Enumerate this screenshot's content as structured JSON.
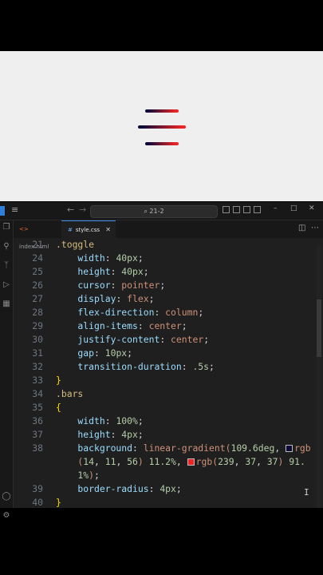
{
  "titlebar": {
    "search_text": "⌕ 21-2"
  },
  "tabs": [
    {
      "label": "index.html",
      "icon": "html-file-icon",
      "active": false
    },
    {
      "label": "style.css",
      "icon": "css-file-icon",
      "active": true
    }
  ],
  "code_lines": [
    {
      "n": "21",
      "parts": [
        [
          "sel",
          ".toggle"
        ]
      ]
    },
    {
      "n": "24",
      "parts": [
        [
          "prop",
          "    width"
        ],
        [
          "pun",
          ": "
        ],
        [
          "num",
          "40px"
        ],
        [
          "pun",
          ";"
        ]
      ]
    },
    {
      "n": "25",
      "parts": [
        [
          "prop",
          "    height"
        ],
        [
          "pun",
          ": "
        ],
        [
          "num",
          "40px"
        ],
        [
          "pun",
          ";"
        ]
      ]
    },
    {
      "n": "26",
      "parts": [
        [
          "prop",
          "    cursor"
        ],
        [
          "pun",
          ": "
        ],
        [
          "val",
          "pointer"
        ],
        [
          "pun",
          ";"
        ]
      ]
    },
    {
      "n": "27",
      "parts": [
        [
          "prop",
          "    display"
        ],
        [
          "pun",
          ": "
        ],
        [
          "val",
          "flex"
        ],
        [
          "pun",
          ";"
        ]
      ]
    },
    {
      "n": "28",
      "parts": [
        [
          "prop",
          "    flex-direction"
        ],
        [
          "pun",
          ": "
        ],
        [
          "val",
          "column"
        ],
        [
          "pun",
          ";"
        ]
      ]
    },
    {
      "n": "29",
      "parts": [
        [
          "prop",
          "    align-items"
        ],
        [
          "pun",
          ": "
        ],
        [
          "val",
          "center"
        ],
        [
          "pun",
          ";"
        ]
      ]
    },
    {
      "n": "30",
      "parts": [
        [
          "prop",
          "    justify-content"
        ],
        [
          "pun",
          ": "
        ],
        [
          "val",
          "center"
        ],
        [
          "pun",
          ";"
        ]
      ]
    },
    {
      "n": "31",
      "parts": [
        [
          "prop",
          "    gap"
        ],
        [
          "pun",
          ": "
        ],
        [
          "num",
          "10px"
        ],
        [
          "pun",
          ";"
        ]
      ]
    },
    {
      "n": "32",
      "parts": [
        [
          "prop",
          "    transition-duration"
        ],
        [
          "pun",
          ": "
        ],
        [
          "num",
          ".5s"
        ],
        [
          "pun",
          ";"
        ]
      ]
    },
    {
      "n": "33",
      "parts": [
        [
          "brace",
          "}"
        ]
      ]
    },
    {
      "n": "34",
      "parts": [
        [
          "sel",
          ".bars"
        ]
      ]
    },
    {
      "n": "35",
      "parts": [
        [
          "brace",
          "{"
        ]
      ]
    },
    {
      "n": "36",
      "parts": [
        [
          "prop",
          "    width"
        ],
        [
          "pun",
          ": "
        ],
        [
          "num",
          "100%"
        ],
        [
          "pun",
          ";"
        ]
      ]
    },
    {
      "n": "37",
      "parts": [
        [
          "prop",
          "    height"
        ],
        [
          "pun",
          ": "
        ],
        [
          "num",
          "4px"
        ],
        [
          "pun",
          ";"
        ]
      ]
    },
    {
      "n": "38",
      "parts": [
        [
          "prop",
          "    background"
        ],
        [
          "pun",
          ": "
        ],
        [
          "val",
          "linear-gradient("
        ],
        [
          "num",
          "109.6deg"
        ],
        [
          "pun",
          ", "
        ],
        [
          "swatch",
          "#0e0b38"
        ],
        [
          "val",
          "rgb"
        ]
      ]
    },
    {
      "n": "",
      "parts": [
        [
          "val",
          "    ("
        ],
        [
          "num",
          "14"
        ],
        [
          "pun",
          ", "
        ],
        [
          "num",
          "11"
        ],
        [
          "pun",
          ", "
        ],
        [
          "num",
          "56"
        ],
        [
          "val",
          ") "
        ],
        [
          "num",
          "11.2%"
        ],
        [
          "pun",
          ", "
        ],
        [
          "swatch",
          "#ef2525"
        ],
        [
          "val",
          "rgb("
        ],
        [
          "num",
          "239"
        ],
        [
          "pun",
          ", "
        ],
        [
          "num",
          "37"
        ],
        [
          "pun",
          ", "
        ],
        [
          "num",
          "37"
        ],
        [
          "val",
          ") "
        ],
        [
          "num",
          "91."
        ]
      ]
    },
    {
      "n": "",
      "parts": [
        [
          "num",
          "    1%"
        ],
        [
          "val",
          ")"
        ],
        [
          "pun",
          ";"
        ]
      ]
    },
    {
      "n": "39",
      "parts": [
        [
          "prop",
          "    border-radius"
        ],
        [
          "pun",
          ": "
        ],
        [
          "num",
          "4px"
        ],
        [
          "pun",
          ";"
        ]
      ]
    },
    {
      "n": "40",
      "parts": [
        [
          "brace",
          "}"
        ]
      ]
    }
  ],
  "colors": {
    "gradient_start": "#0e0b38",
    "gradient_end": "#ef2525",
    "editor_bg": "#1f1f1f",
    "accent": "#3b8eea"
  }
}
